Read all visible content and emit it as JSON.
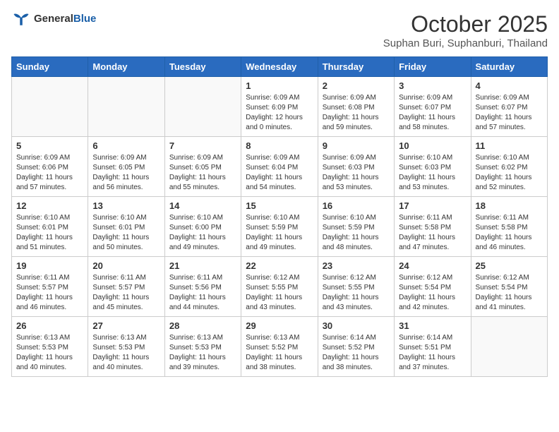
{
  "header": {
    "logo_general": "General",
    "logo_blue": "Blue",
    "month_title": "October 2025",
    "location": "Suphan Buri, Suphanburi, Thailand"
  },
  "weekdays": [
    "Sunday",
    "Monday",
    "Tuesday",
    "Wednesday",
    "Thursday",
    "Friday",
    "Saturday"
  ],
  "weeks": [
    [
      {
        "day": "",
        "info": ""
      },
      {
        "day": "",
        "info": ""
      },
      {
        "day": "",
        "info": ""
      },
      {
        "day": "1",
        "info": "Sunrise: 6:09 AM\nSunset: 6:09 PM\nDaylight: 12 hours\nand 0 minutes."
      },
      {
        "day": "2",
        "info": "Sunrise: 6:09 AM\nSunset: 6:08 PM\nDaylight: 11 hours\nand 59 minutes."
      },
      {
        "day": "3",
        "info": "Sunrise: 6:09 AM\nSunset: 6:07 PM\nDaylight: 11 hours\nand 58 minutes."
      },
      {
        "day": "4",
        "info": "Sunrise: 6:09 AM\nSunset: 6:07 PM\nDaylight: 11 hours\nand 57 minutes."
      }
    ],
    [
      {
        "day": "5",
        "info": "Sunrise: 6:09 AM\nSunset: 6:06 PM\nDaylight: 11 hours\nand 57 minutes."
      },
      {
        "day": "6",
        "info": "Sunrise: 6:09 AM\nSunset: 6:05 PM\nDaylight: 11 hours\nand 56 minutes."
      },
      {
        "day": "7",
        "info": "Sunrise: 6:09 AM\nSunset: 6:05 PM\nDaylight: 11 hours\nand 55 minutes."
      },
      {
        "day": "8",
        "info": "Sunrise: 6:09 AM\nSunset: 6:04 PM\nDaylight: 11 hours\nand 54 minutes."
      },
      {
        "day": "9",
        "info": "Sunrise: 6:09 AM\nSunset: 6:03 PM\nDaylight: 11 hours\nand 53 minutes."
      },
      {
        "day": "10",
        "info": "Sunrise: 6:10 AM\nSunset: 6:03 PM\nDaylight: 11 hours\nand 53 minutes."
      },
      {
        "day": "11",
        "info": "Sunrise: 6:10 AM\nSunset: 6:02 PM\nDaylight: 11 hours\nand 52 minutes."
      }
    ],
    [
      {
        "day": "12",
        "info": "Sunrise: 6:10 AM\nSunset: 6:01 PM\nDaylight: 11 hours\nand 51 minutes."
      },
      {
        "day": "13",
        "info": "Sunrise: 6:10 AM\nSunset: 6:01 PM\nDaylight: 11 hours\nand 50 minutes."
      },
      {
        "day": "14",
        "info": "Sunrise: 6:10 AM\nSunset: 6:00 PM\nDaylight: 11 hours\nand 49 minutes."
      },
      {
        "day": "15",
        "info": "Sunrise: 6:10 AM\nSunset: 5:59 PM\nDaylight: 11 hours\nand 49 minutes."
      },
      {
        "day": "16",
        "info": "Sunrise: 6:10 AM\nSunset: 5:59 PM\nDaylight: 11 hours\nand 48 minutes."
      },
      {
        "day": "17",
        "info": "Sunrise: 6:11 AM\nSunset: 5:58 PM\nDaylight: 11 hours\nand 47 minutes."
      },
      {
        "day": "18",
        "info": "Sunrise: 6:11 AM\nSunset: 5:58 PM\nDaylight: 11 hours\nand 46 minutes."
      }
    ],
    [
      {
        "day": "19",
        "info": "Sunrise: 6:11 AM\nSunset: 5:57 PM\nDaylight: 11 hours\nand 46 minutes."
      },
      {
        "day": "20",
        "info": "Sunrise: 6:11 AM\nSunset: 5:57 PM\nDaylight: 11 hours\nand 45 minutes."
      },
      {
        "day": "21",
        "info": "Sunrise: 6:11 AM\nSunset: 5:56 PM\nDaylight: 11 hours\nand 44 minutes."
      },
      {
        "day": "22",
        "info": "Sunrise: 6:12 AM\nSunset: 5:55 PM\nDaylight: 11 hours\nand 43 minutes."
      },
      {
        "day": "23",
        "info": "Sunrise: 6:12 AM\nSunset: 5:55 PM\nDaylight: 11 hours\nand 43 minutes."
      },
      {
        "day": "24",
        "info": "Sunrise: 6:12 AM\nSunset: 5:54 PM\nDaylight: 11 hours\nand 42 minutes."
      },
      {
        "day": "25",
        "info": "Sunrise: 6:12 AM\nSunset: 5:54 PM\nDaylight: 11 hours\nand 41 minutes."
      }
    ],
    [
      {
        "day": "26",
        "info": "Sunrise: 6:13 AM\nSunset: 5:53 PM\nDaylight: 11 hours\nand 40 minutes."
      },
      {
        "day": "27",
        "info": "Sunrise: 6:13 AM\nSunset: 5:53 PM\nDaylight: 11 hours\nand 40 minutes."
      },
      {
        "day": "28",
        "info": "Sunrise: 6:13 AM\nSunset: 5:53 PM\nDaylight: 11 hours\nand 39 minutes."
      },
      {
        "day": "29",
        "info": "Sunrise: 6:13 AM\nSunset: 5:52 PM\nDaylight: 11 hours\nand 38 minutes."
      },
      {
        "day": "30",
        "info": "Sunrise: 6:14 AM\nSunset: 5:52 PM\nDaylight: 11 hours\nand 38 minutes."
      },
      {
        "day": "31",
        "info": "Sunrise: 6:14 AM\nSunset: 5:51 PM\nDaylight: 11 hours\nand 37 minutes."
      },
      {
        "day": "",
        "info": ""
      }
    ]
  ]
}
